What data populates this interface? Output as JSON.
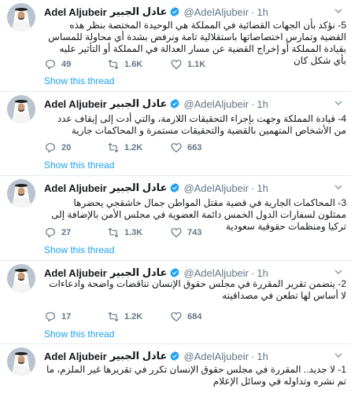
{
  "author": {
    "name": "Adel Aljubeir",
    "arabic_name": "عادل الجبير",
    "handle": "@AdelAljubeir",
    "separator": "·",
    "time": "1h"
  },
  "show_thread_label": "Show this thread",
  "tweets": [
    {
      "text": "5- نؤكد بأن الجهات القضائية في المملكة هي الوحيدة المختصة بنظر هذه القضية وتمارس اختصاصاتها باستقلالية تامة ونرفض بشدة أي محاولة للمساس بقيادة المملكة أو إخراج القضية عن مسار العدالة في المملكة أو التأثير عليه بأي شكل كان",
      "replies": "49",
      "retweets": "1.6K",
      "likes": "1.1K"
    },
    {
      "text": "4- قيادة المملكة وجهت بإجراء التحقيقات اللازمة، والتي أدت إلى إيقاف عدد من الأشخاص المتهمين بالقضية والتحقيقات مستمرة و المحاكمات جارية",
      "replies": "20",
      "retweets": "1.2K",
      "likes": "663"
    },
    {
      "text": "3- المحاكمات الجارية في قضية مقتل المواطن جمال خاشقجي يحضرها ممثلون لسفارات الدول الخمس دائمة العضوية في مجلس الأمن بالإضافة إلى تركيا ومنظمات حقوقية سعودية",
      "replies": "27",
      "retweets": "1.3K",
      "likes": "743"
    },
    {
      "text": "2- يتضمن تقرير المقررة في مجلس حقوق الإنسان تناقضات واضحة وادعاءات لا أساس لها تطعن في مصداقيته",
      "replies": "17",
      "retweets": "1.2K",
      "likes": "684"
    },
    {
      "text": "1- لا جديد.. المقررة في مجلس حقوق الإنسان تكرر في تقريرها غير الملزم، ما تم نشره وتداوله في وسائل الإعلام",
      "replies": "",
      "retweets": "",
      "likes": ""
    }
  ],
  "colors": {
    "link": "#1da1f2",
    "muted": "#657786",
    "divider": "#e6ecf0",
    "verified": "#1da1f2"
  }
}
